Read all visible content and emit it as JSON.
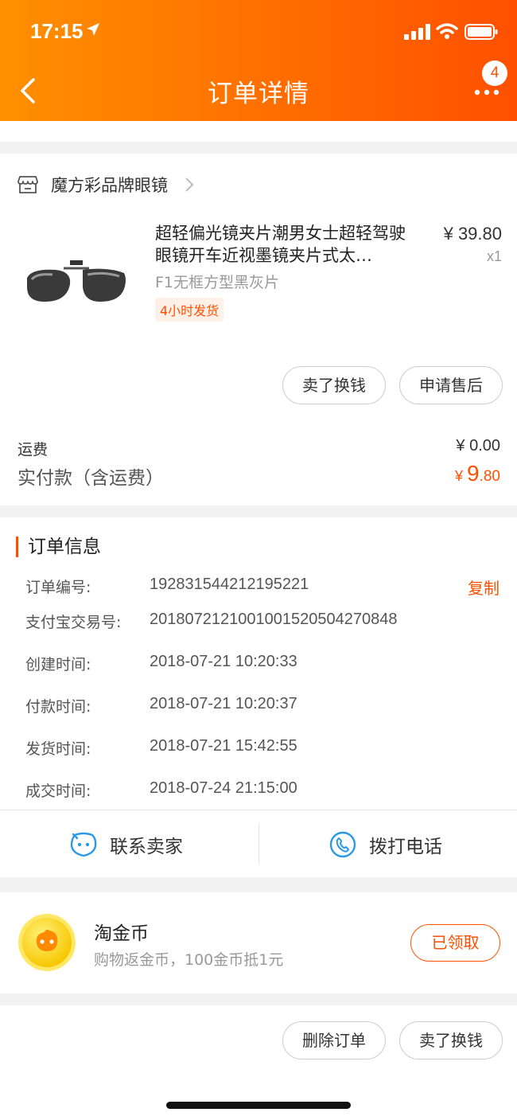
{
  "status_bar": {
    "time": "17:15"
  },
  "nav": {
    "title": "订单详情",
    "badge_count": "4"
  },
  "shop": {
    "name": "魔方彩品牌眼镜"
  },
  "product": {
    "title": "超轻偏光镜夹片潮男女士超轻驾驶眼镜开车近视墨镜夹片式太…",
    "price": "¥ 39.80",
    "quantity": "x1",
    "sku": "F1无框方型黑灰片",
    "tag": "4小时发货"
  },
  "product_actions": {
    "sell_label": "卖了换钱",
    "after_sale_label": "申请售后"
  },
  "summary": {
    "shipping_label": "运费",
    "shipping_value": "¥ 0.00",
    "paid_label": "实付款（含运费）",
    "paid_currency": "¥ ",
    "paid_integer": "9",
    "paid_decimal": ".80"
  },
  "order_info": {
    "heading": "订单信息",
    "copy_label": "复制",
    "rows": [
      {
        "label": "订单编号:",
        "value": "192831544212195221"
      },
      {
        "label": "支付宝交易号:",
        "value": "2018072121001001520504270848"
      },
      {
        "label": "创建时间:",
        "value": "2018-07-21 10:20:33"
      },
      {
        "label": "付款时间:",
        "value": "2018-07-21 10:20:37"
      },
      {
        "label": "发货时间:",
        "value": "2018-07-21 15:42:55"
      },
      {
        "label": "成交时间:",
        "value": "2018-07-24 21:15:00"
      }
    ]
  },
  "contact": {
    "seller_label": "联系卖家",
    "call_label": "拨打电话"
  },
  "coins": {
    "title": "淘金币",
    "description": "购物返金币，100金币抵1元",
    "button_label": "已领取"
  },
  "bottom_actions": {
    "delete_label": "删除订单",
    "sell_label": "卖了换钱"
  },
  "colors": {
    "accent": "#ff5000",
    "header_start": "#ff9000",
    "header_end": "#ff5000",
    "icon_blue": "#2b9ae6"
  },
  "icons": [
    "location-arrow-icon",
    "signal-icon",
    "wifi-icon",
    "battery-icon",
    "back-chevron-icon",
    "more-dots-icon",
    "shop-icon",
    "chevron-right-icon",
    "chat-face-icon",
    "phone-icon",
    "gold-coin-icon"
  ]
}
